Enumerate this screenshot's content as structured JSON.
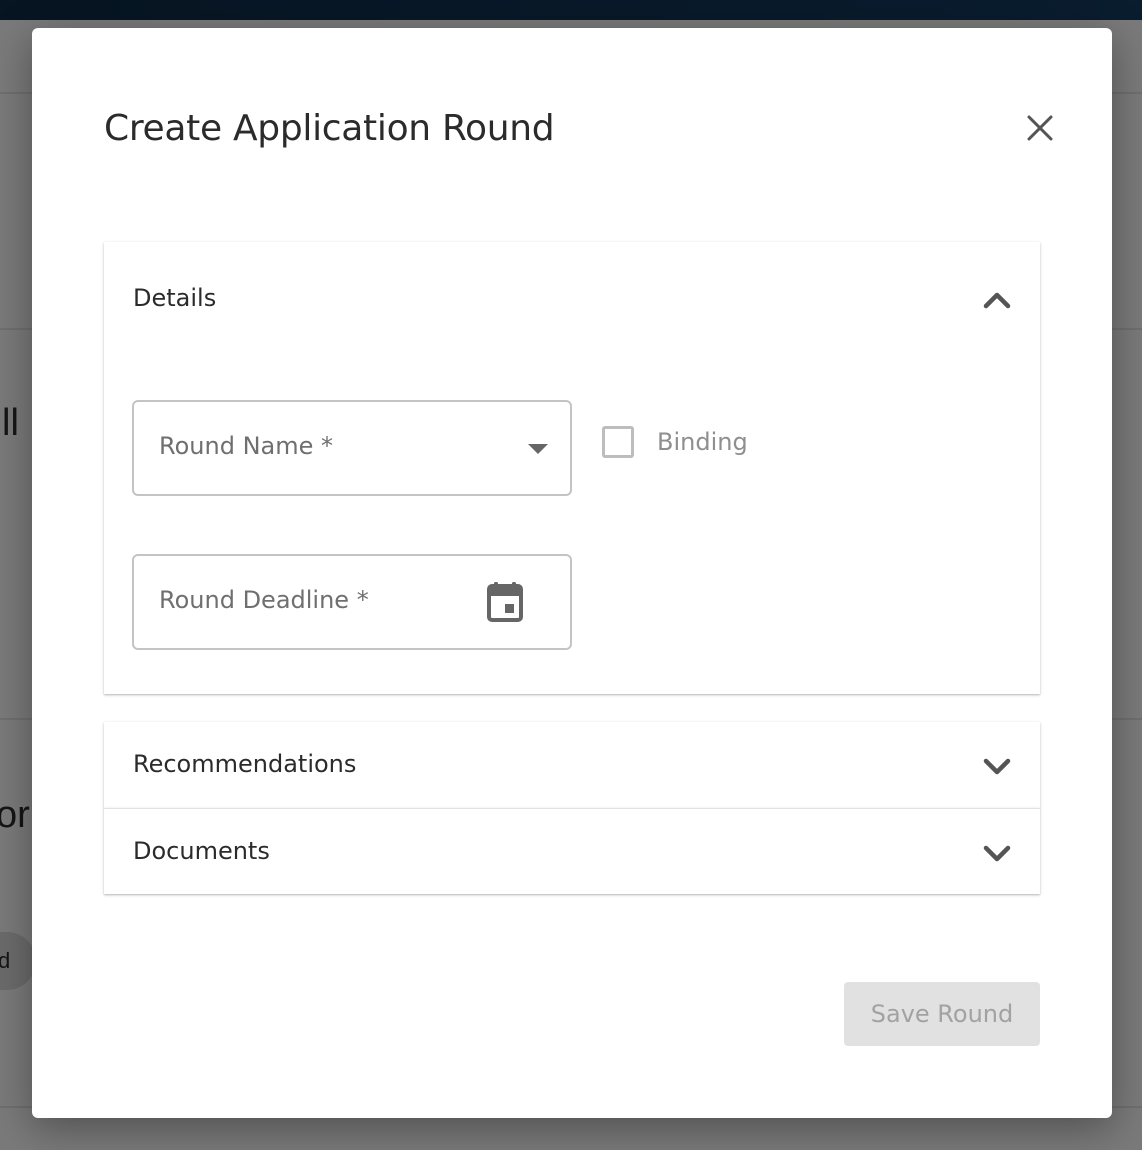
{
  "modal": {
    "title": "Create Application Round",
    "close_icon": "close-icon"
  },
  "sections": {
    "details": {
      "title": "Details",
      "expanded": true,
      "icon": "chevron-up-icon"
    },
    "recommendations": {
      "title": "Recommendations",
      "expanded": false,
      "icon": "chevron-down-icon"
    },
    "documents": {
      "title": "Documents",
      "expanded": false,
      "icon": "chevron-down-icon"
    }
  },
  "form": {
    "round_name": {
      "label": "Round Name *",
      "value": ""
    },
    "binding": {
      "label": "Binding",
      "checked": false
    },
    "round_deadline": {
      "label": "Round Deadline *",
      "value": "",
      "icon": "calendar-icon"
    }
  },
  "actions": {
    "save_label": "Save Round",
    "save_disabled": true
  },
  "background": {
    "fragments": [
      "ll",
      "or",
      "d"
    ]
  },
  "colors": {
    "topbar": "#143a5e",
    "overlay": "rgba(0,0,0,0.5)",
    "text": "#2b2b2b",
    "disabled_button": "#e1e1e1"
  }
}
